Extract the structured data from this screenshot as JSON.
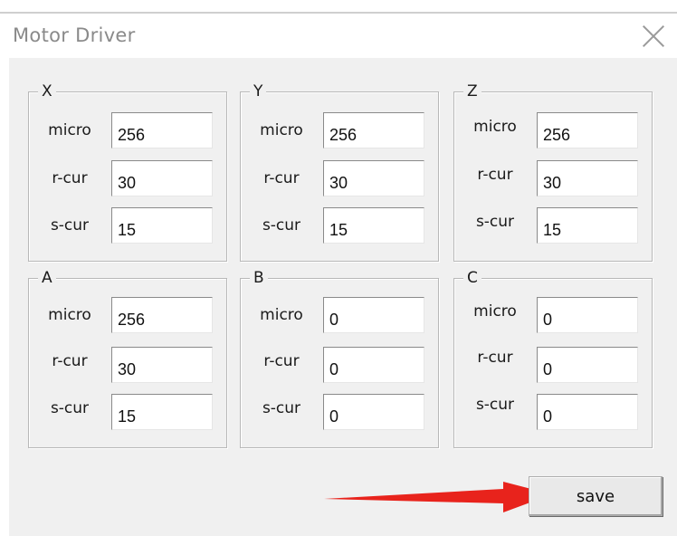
{
  "window": {
    "title": "Motor Driver",
    "close_icon": "close-icon"
  },
  "labels": {
    "micro": "micro",
    "rcur": "r-cur",
    "scur": "s-cur"
  },
  "axes": [
    {
      "name": "X",
      "micro": "256",
      "r_cur": "30",
      "s_cur": "15"
    },
    {
      "name": "Y",
      "micro": "256",
      "r_cur": "30",
      "s_cur": "15"
    },
    {
      "name": "Z",
      "micro": "256",
      "r_cur": "30",
      "s_cur": "15"
    },
    {
      "name": "A",
      "micro": "256",
      "r_cur": "30",
      "s_cur": "15"
    },
    {
      "name": "B",
      "micro": "0",
      "r_cur": "0",
      "s_cur": "0"
    },
    {
      "name": "C",
      "micro": "0",
      "r_cur": "0",
      "s_cur": "0"
    }
  ],
  "actions": {
    "save_label": "save"
  },
  "colors": {
    "annotation_arrow": "#e8231c",
    "dialog_bg": "#f0f0f0"
  }
}
